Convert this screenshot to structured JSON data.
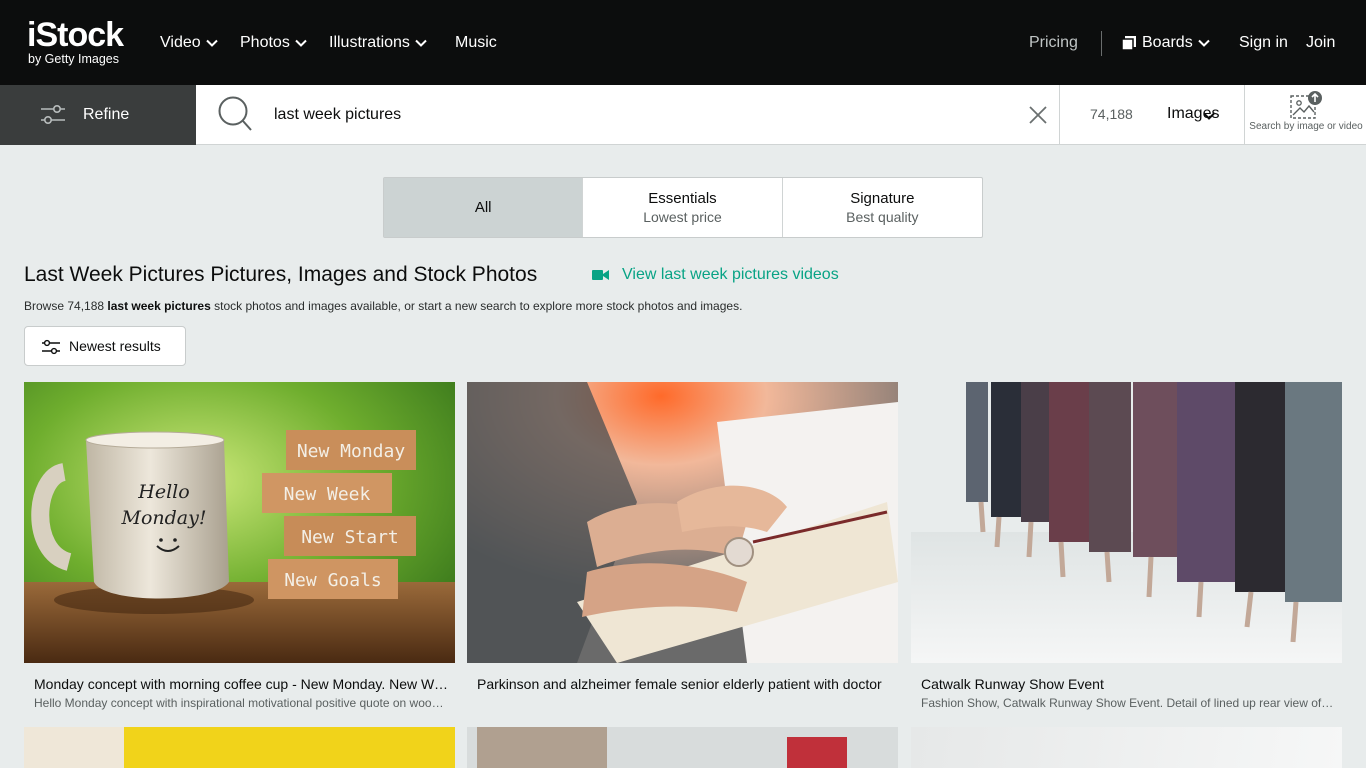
{
  "brand": {
    "logo_main": "iStock",
    "logo_sub": "by Getty Images"
  },
  "nav": {
    "items": [
      {
        "label": "Video",
        "has_menu": true
      },
      {
        "label": "Photos",
        "has_menu": true
      },
      {
        "label": "Illustrations",
        "has_menu": true
      },
      {
        "label": "Music",
        "has_menu": false
      }
    ],
    "pricing": "Pricing",
    "boards": "Boards",
    "sign_in": "Sign in",
    "join": "Join"
  },
  "search": {
    "refine_label": "Refine",
    "query": "last week pictures",
    "result_count": "74,188",
    "media_type": "Images",
    "search_by_image_label": "Search by image or video"
  },
  "tiers": [
    {
      "name": "All",
      "sub": "",
      "active": true
    },
    {
      "name": "Essentials",
      "sub": "Lowest price",
      "active": false
    },
    {
      "name": "Signature",
      "sub": "Best quality",
      "active": false
    }
  ],
  "heading": {
    "title": "Last Week Pictures Pictures, Images and Stock Photos",
    "videos_link": "View last week pictures videos",
    "browse_prefix": "Browse 74,188 ",
    "browse_bold": "last week pictures",
    "browse_suffix": " stock photos and images available, or start a new search to explore more stock photos and images."
  },
  "sort": {
    "label": "Newest results"
  },
  "results": [
    {
      "title": "Monday concept with morning coffee cup - New Monday. New Week. New Start. New Goals.",
      "desc": "Hello Monday concept with inspirational motivational positive quote on wooden blocks",
      "img_text": {
        "mug": "Hello Monday!",
        "blocks": [
          "New Monday",
          "New Week",
          "New Start",
          "New Goals"
        ]
      }
    },
    {
      "title": "Parkinson and alzheimer female senior elderly patient with doctor",
      "desc": ""
    },
    {
      "title": "Catwalk Runway Show Event",
      "desc": "Fashion Show, Catwalk Runway Show Event. Detail of lined up rear view of models"
    }
  ],
  "colors": {
    "accent": "#08a385",
    "topbar": "#0c0d0d",
    "refine_bg": "#3a3d3d",
    "page_bg": "#e8ecec"
  }
}
